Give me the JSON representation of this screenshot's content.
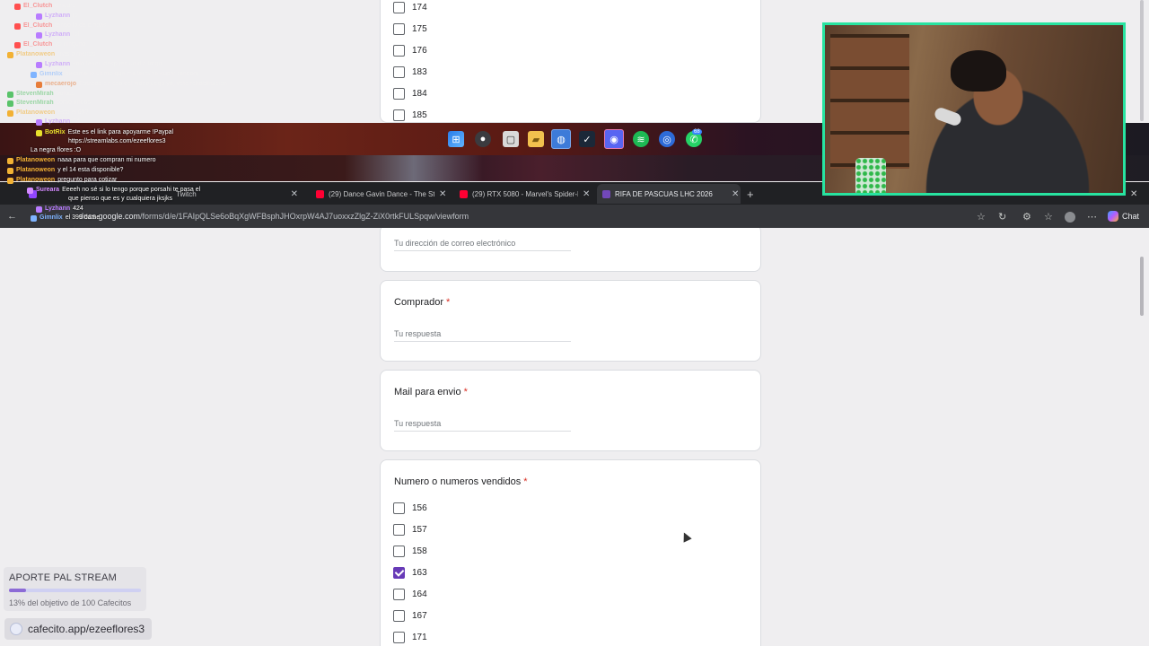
{
  "form": {
    "top_options": [
      "174",
      "175",
      "176",
      "183",
      "184",
      "185"
    ],
    "email_placeholder": "Tu dirección de correo electrónico",
    "questions": [
      {
        "title": "Comprador",
        "required_mark": "*",
        "placeholder": "Tu respuesta"
      },
      {
        "title": "Mail para envio",
        "required_mark": "*",
        "placeholder": "Tu respuesta"
      }
    ],
    "numbers_question": {
      "title": "Numero o numeros vendidos",
      "required_mark": "*",
      "options": [
        {
          "label": "156",
          "checked": false
        },
        {
          "label": "157",
          "checked": false
        },
        {
          "label": "158",
          "checked": false
        },
        {
          "label": "163",
          "checked": true
        },
        {
          "label": "164",
          "checked": false
        },
        {
          "label": "167",
          "checked": false
        },
        {
          "label": "171",
          "checked": false
        }
      ]
    }
  },
  "browser": {
    "tabs": [
      {
        "label": "Twitch",
        "close": "✕"
      },
      {
        "label": "(29) Dance Gavin Dance - The Stic",
        "close": "✕"
      },
      {
        "label": "(29) RTX 5080 - Marvel's Spider-M",
        "close": "✕"
      },
      {
        "label": "RIFA DE PASCUAS LHC 2026",
        "close": "✕"
      }
    ],
    "new_tab": "+",
    "window_close": "✕",
    "url_host": "docs.google.com",
    "url_path": "/forms/d/e/1FAIpQLSe6oBqXgWFBsphJHOxrpW4AJ7uoxxzZlgZ-ZiX0rtkFULSpqw/viewform",
    "chat_button": "Chat"
  },
  "taskbar": {
    "discord_badge": "68"
  },
  "chat": [
    {
      "user": "El_Clutch",
      "msg": "dinguro",
      "color": "#ff4f4f",
      "faded": true
    },
    {
      "user": "Lyzhann",
      "msg": "jo",
      "color": "#b87cff",
      "faded": true
    },
    {
      "user": "El_Clutch",
      "msg": "tengo lo de dinoas",
      "color": "#ff4f4f",
      "faded": true
    },
    {
      "user": "Lyzhann",
      "msg": "lol",
      "color": "#b87cff",
      "faded": true
    },
    {
      "user": "El_Clutch",
      "msg": "yo ninguno",
      "color": "#ff4f4f",
      "faded": true
    },
    {
      "user": "Platanoweon",
      "msg": "mas o menos",
      "color": "#f2b134",
      "faded": true
    },
    {
      "user": "Lyzhann",
      "msg": "solo team, despues un dia largo",
      "color": "#b87cff",
      "faded": true
    },
    {
      "user": "Gimnlix",
      "msg": "pasame lo ultimo que me termine super random",
      "color": "#7fb4ff",
      "faded": true
    },
    {
      "user": "mecaerojo",
      "msg": "Estabas en esa del videojuego ya, vete rehabilitacion",
      "color": "#e77d3a",
      "faded": true
    },
    {
      "user": "StevenMirah",
      "msg": "boludo",
      "color": "#59c36a",
      "faded": true
    },
    {
      "user": "StevenMirah",
      "msg": "como andas",
      "color": "#59c36a",
      "faded": true
    },
    {
      "user": "Platanoweon",
      "msg": "esta el 69?",
      "color": "#f2b134",
      "faded": true
    },
    {
      "user": "Lyzhann",
      "msg": "24",
      "color": "#b87cff",
      "faded": true
    },
    {
      "user": "BotRix",
      "msg": "Este es el link para apoyarme !Paypal",
      "color": "#e8e12c",
      "faded": false
    },
    {
      "user": "",
      "msg": "https://streamlabs.com/ezeeflores3",
      "color": "#e8e12c",
      "faded": false
    },
    {
      "user": "",
      "msg": "La negra flores :O",
      "color": "#f2b134",
      "faded": false
    },
    {
      "user": "Platanoweon",
      "msg": "naaa para que compran mi numero",
      "color": "#f2b134",
      "faded": false
    },
    {
      "user": "Platanoweon",
      "msg": "y el 14 esta disponible?",
      "color": "#f2b134",
      "faded": false
    },
    {
      "user": "Platanoweon",
      "msg": "pregunto para cotizar",
      "color": "#f2b134",
      "faded": false
    },
    {
      "user": "Sureara",
      "msg": "Eeeeh no sé si lo tengo porque porsahi te pasa el",
      "color": "#d48aff",
      "faded": false
    },
    {
      "user": "",
      "msg": "que pienso que es y cualquiera jksjks",
      "color": "#d48aff",
      "faded": false
    },
    {
      "user": "Lyzhann",
      "msg": "424",
      "color": "#b87cff",
      "faded": false
    },
    {
      "user": "Gimnlix",
      "msg": "el 399 dame",
      "color": "#7fb4ff",
      "faded": false
    }
  ],
  "aporte": {
    "title": "APORTE PAL STREAM",
    "progress_percent": 13,
    "text": "13% del objetivo de 100 Cafecitos",
    "link": "cafecito.app/ezeeflores3"
  },
  "colors": {
    "form_accent": "#673ab7",
    "required": "#d93025",
    "cam_border": "#28e3a0"
  }
}
